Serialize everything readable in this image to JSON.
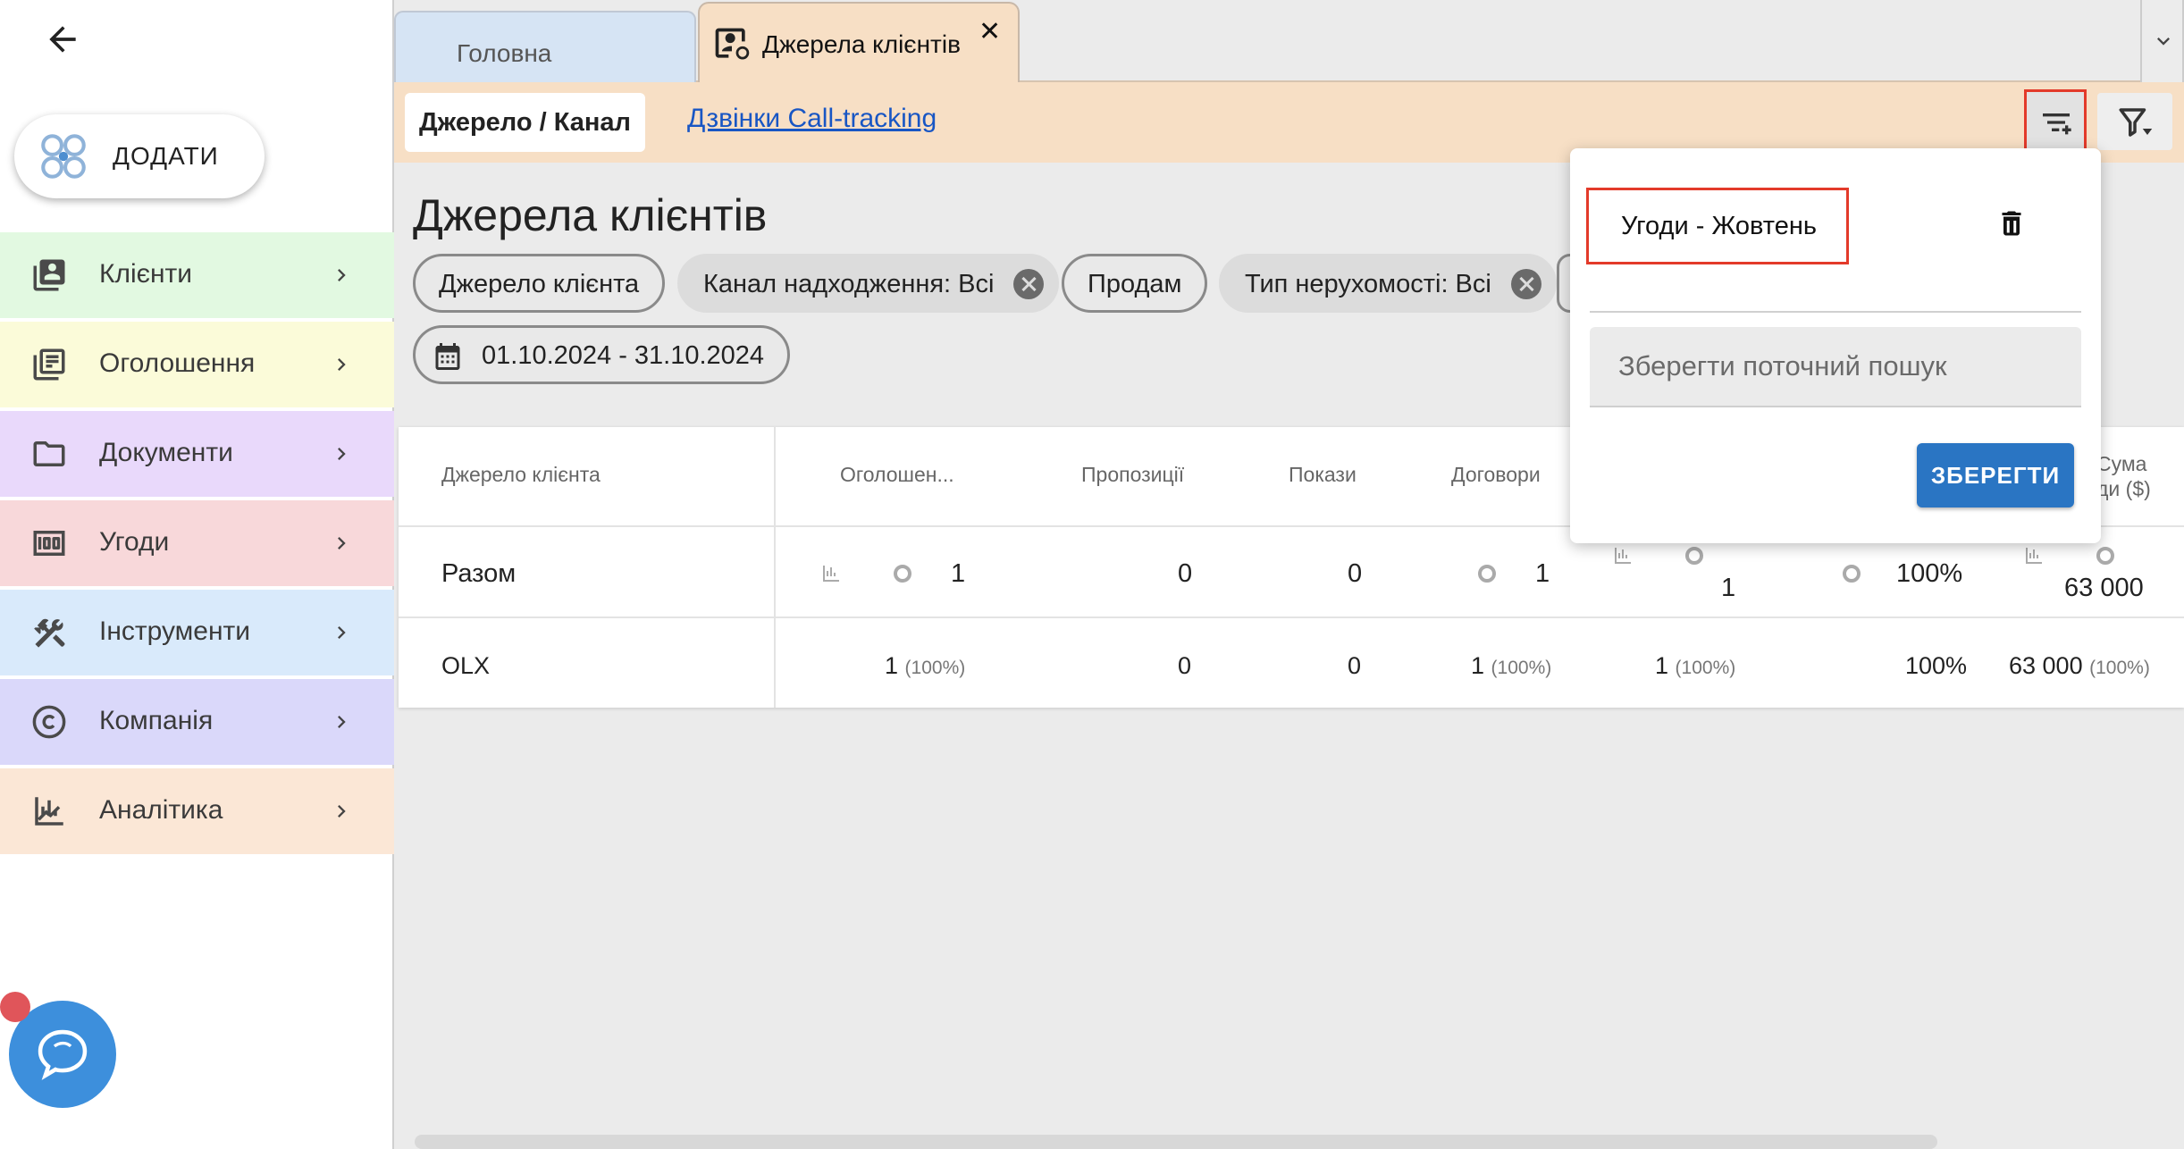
{
  "sidebar": {
    "add_label": "ДОДАТИ",
    "items": [
      {
        "label": "Клієнти",
        "icon": "clients-icon",
        "color": "#e2f9e1"
      },
      {
        "label": "Оголошення",
        "icon": "listings-icon",
        "color": "#fbfbd9"
      },
      {
        "label": "Документи",
        "icon": "folder-icon",
        "color": "#e9d9fb"
      },
      {
        "label": "Угоди",
        "icon": "money-icon",
        "color": "#f8d8da"
      },
      {
        "label": "Інструменти",
        "icon": "tools-icon",
        "color": "#d9eafb"
      },
      {
        "label": "Компанія",
        "icon": "copyright-icon",
        "color": "#dad8fa"
      },
      {
        "label": "Аналітика",
        "icon": "analytics-icon",
        "color": "#fbe7d6"
      }
    ]
  },
  "tabs": {
    "home": "Головна",
    "active": "Джерела клієнтів",
    "close": "✕"
  },
  "subbar": {
    "chip": "Джерело / Канал",
    "link": "Дзвінки Call-tracking"
  },
  "main": {
    "title": "Джерела клієнтів",
    "filters": [
      "Джерело клієнта",
      "Канал надходження: Всі",
      "Продам",
      "Тип нерухомості: Всі"
    ],
    "date_range": "01.10.2024 - 31.10.2024"
  },
  "table": {
    "headers": [
      "Джерело клієнта",
      "Оголошен...",
      "Пропозиції",
      "Покази",
      "Договори",
      "Сума",
      "ди ($)"
    ],
    "total": {
      "label": "Разом",
      "listings": "1",
      "offers": "0",
      "shows": "0",
      "contracts": "1",
      "deals": "1",
      "percent": "100%",
      "sum": "63 000"
    },
    "rows": [
      {
        "label": "OLX",
        "listings": "1",
        "listings_pct": "(100%)",
        "offers": "0",
        "shows": "0",
        "contracts": "1",
        "contracts_pct": "(100%)",
        "deals": "1",
        "deals_pct": "(100%)",
        "percent": "100%",
        "sum": "63 000",
        "sum_pct": "(100%)"
      }
    ]
  },
  "popup": {
    "saved_search": "Угоди - Жовтень",
    "input_placeholder": "Зберегти поточний пошук",
    "save_button": "ЗБЕРЕГТИ"
  },
  "colors": {
    "accent": "#2a75c3",
    "highlight": "#e33a2a",
    "subbar": "#f7dfc5",
    "link": "#1856c4"
  }
}
